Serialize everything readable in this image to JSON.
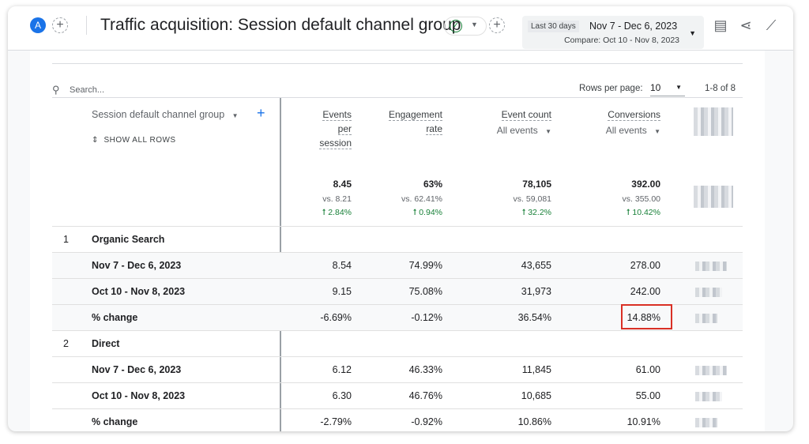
{
  "header": {
    "avatar": "A",
    "title": "Traffic acquisition: Session default channel group",
    "status_icon": "check-circle",
    "date": {
      "preset": "Last 30 days",
      "range": "Nov 7 - Dec 6, 2023",
      "compare": "Compare: Oct 10 - Nov 8, 2023"
    },
    "icons": [
      "customize-report-icon",
      "share-icon",
      "insights-icon"
    ]
  },
  "toolbar": {
    "search_placeholder": "Search...",
    "rows_per_page_label": "Rows per page:",
    "rows_per_page": "10",
    "pagination": "1-8 of 8"
  },
  "table": {
    "dimension": "Session default channel group",
    "show_all": "SHOW ALL ROWS",
    "columns": [
      {
        "l1": "Events",
        "l2": "per",
        "l3": "session",
        "sub": ""
      },
      {
        "l1": "Engagement",
        "l2": "rate",
        "l3": "",
        "sub": ""
      },
      {
        "l1": "Event count",
        "l2": "",
        "l3": "",
        "sub": "All events"
      },
      {
        "l1": "Conversions",
        "l2": "",
        "l3": "",
        "sub": "All events"
      }
    ],
    "totals": [
      {
        "value": "8.45",
        "vs": "vs. 8.21",
        "change": "2.84%"
      },
      {
        "value": "63%",
        "vs": "vs. 62.41%",
        "change": "0.94%"
      },
      {
        "value": "78,105",
        "vs": "vs. 59,081",
        "change": "32.2%"
      },
      {
        "value": "392.00",
        "vs": "vs. 355.00",
        "change": "10.42%"
      }
    ],
    "groups": [
      {
        "index": "1",
        "name": "Organic Search",
        "rows": [
          {
            "label": "Nov 7 - Dec 6, 2023",
            "values": [
              "8.54",
              "74.99%",
              "43,655",
              "278.00"
            ]
          },
          {
            "label": "Oct 10 - Nov 8, 2023",
            "values": [
              "9.15",
              "75.08%",
              "31,973",
              "242.00"
            ]
          },
          {
            "label": "% change",
            "values": [
              "-6.69%",
              "-0.12%",
              "36.54%",
              "14.88%"
            ],
            "highlight_col": 3
          }
        ]
      },
      {
        "index": "2",
        "name": "Direct",
        "rows": [
          {
            "label": "Nov 7 - Dec 6, 2023",
            "values": [
              "6.12",
              "46.33%",
              "11,845",
              "61.00"
            ]
          },
          {
            "label": "Oct 10 - Nov 8, 2023",
            "values": [
              "6.30",
              "46.76%",
              "10,685",
              "55.00"
            ]
          },
          {
            "label": "% change",
            "values": [
              "-2.79%",
              "-0.92%",
              "10.86%",
              "10.91%"
            ]
          }
        ]
      }
    ]
  },
  "colors": {
    "accent": "#1a73e8",
    "positive": "#188038",
    "highlight": "#d93025"
  }
}
